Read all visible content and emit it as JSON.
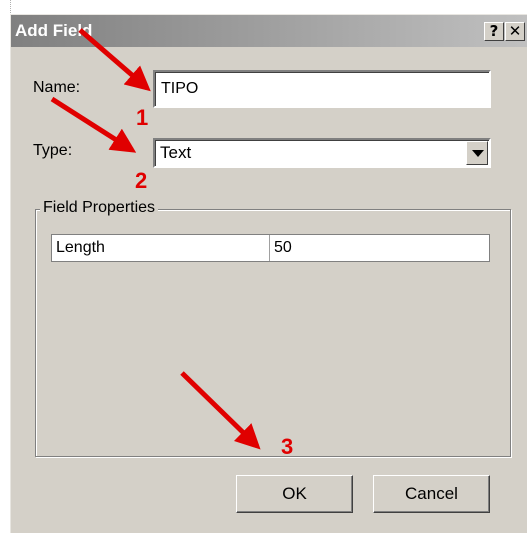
{
  "window": {
    "title": "Add Field",
    "help_glyph": "?",
    "close_glyph": "✕"
  },
  "form": {
    "name_label": "Name:",
    "name_value": "TIPO",
    "type_label": "Type:",
    "type_value": "Text"
  },
  "field_properties": {
    "legend": "Field Properties",
    "rows": [
      {
        "property": "Length",
        "value": "50"
      }
    ]
  },
  "buttons": {
    "ok": "OK",
    "cancel": "Cancel"
  },
  "annotations": {
    "arrow_color": "#e00000",
    "labels": [
      "1",
      "2",
      "3"
    ]
  }
}
